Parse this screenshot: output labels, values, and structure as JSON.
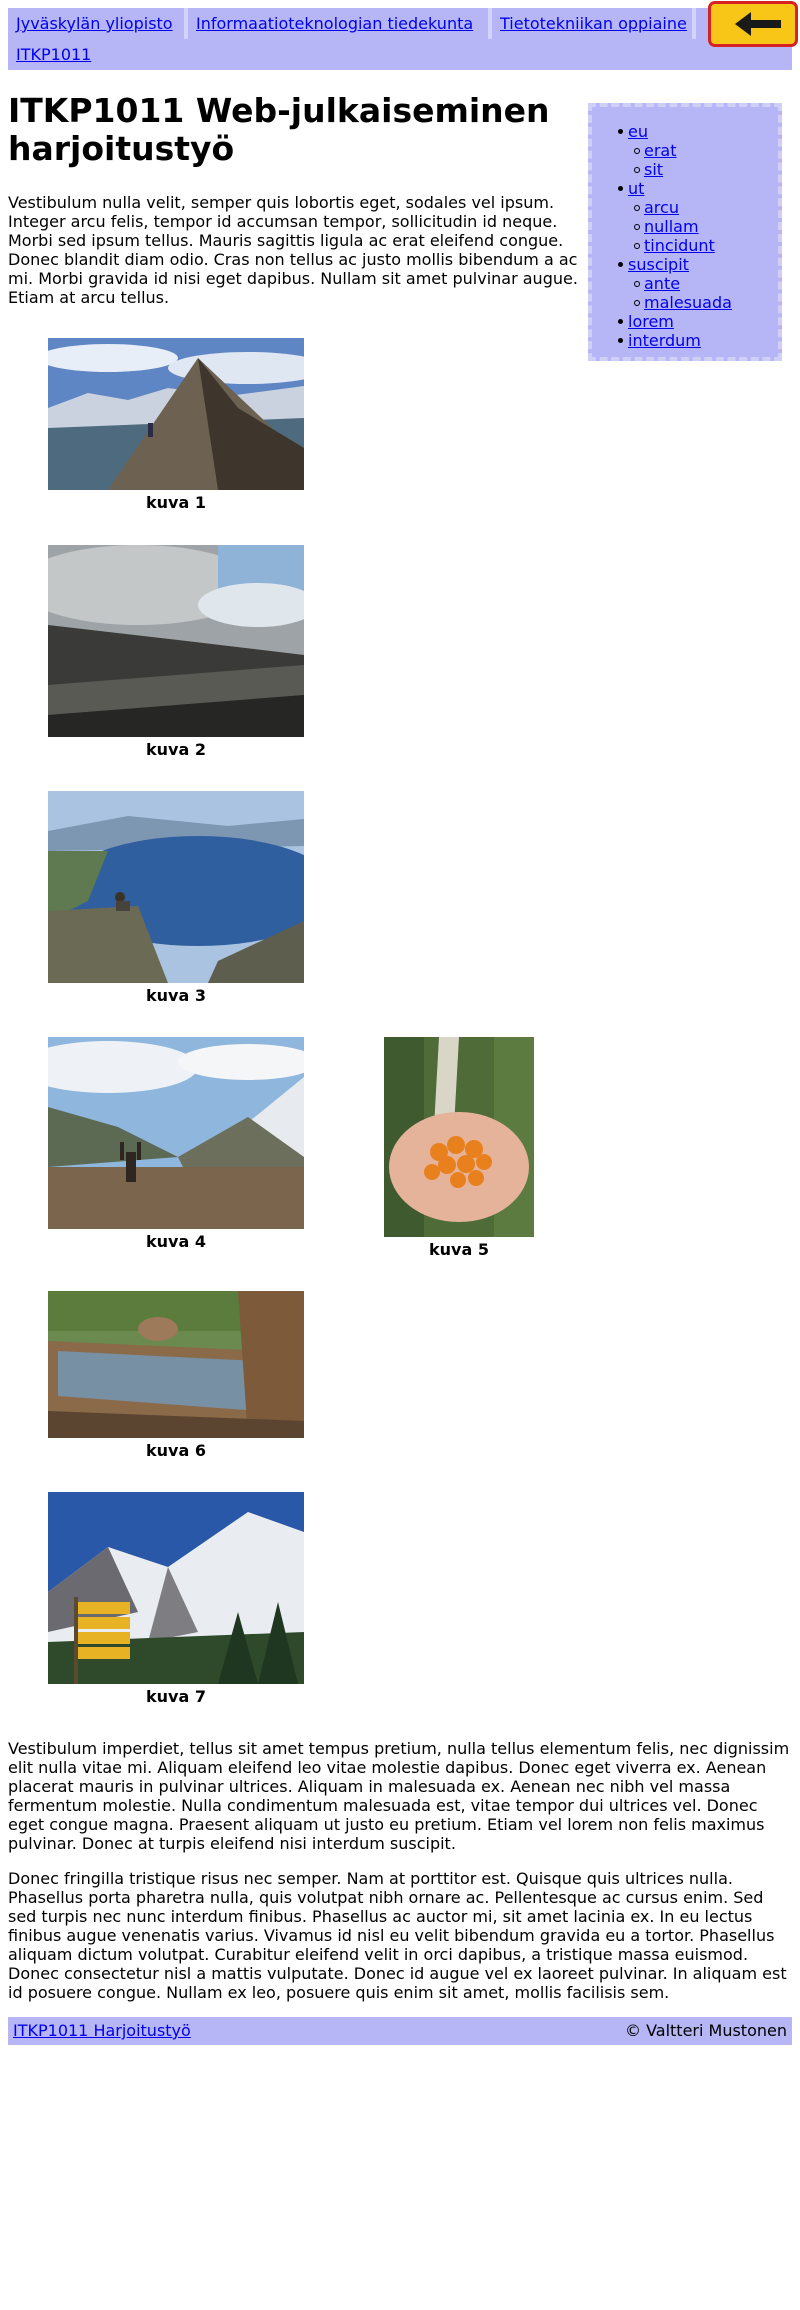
{
  "breadcrumb": [
    {
      "label": "Jyväskylän yliopisto"
    },
    {
      "label": "Informaatioteknologian tiedekunta"
    },
    {
      "label": "Tietotekniikan oppiaine"
    },
    {
      "label": "ITKP1011"
    }
  ],
  "back_button": {
    "icon": "arrow-left-icon",
    "colors": {
      "fill": "#f7c616",
      "border": "#d62222",
      "arrow": "#1a1a1a"
    }
  },
  "page": {
    "title": "ITKP1011 Web-julkaiseminen harjoitustyö",
    "intro": "Vestibulum nulla velit, semper quis lobortis eget, sodales vel ipsum. Integer arcu felis, tempor id accumsan tempor, sollicitudin id neque. Morbi sed ipsum tellus. Mauris sagittis ligula ac erat eleifend congue. Donec blandit diam odio. Cras non tellus ac justo mollis bibendum a ac mi. Morbi gravida id nisi eget dapibus. Nullam sit amet pulvinar augue. Etiam at arcu tellus."
  },
  "sidenav": {
    "items": [
      {
        "label": "eu",
        "children": [
          {
            "label": "erat"
          },
          {
            "label": "sit"
          }
        ]
      },
      {
        "label": "ut",
        "children": [
          {
            "label": "arcu"
          },
          {
            "label": "nullam"
          },
          {
            "label": "tincidunt"
          }
        ]
      },
      {
        "label": "suscipit",
        "children": [
          {
            "label": "ante"
          },
          {
            "label": "malesuada"
          }
        ]
      },
      {
        "label": "lorem",
        "children": []
      },
      {
        "label": "interdum",
        "children": []
      }
    ]
  },
  "gallery": [
    {
      "caption": "kuva 1",
      "scene": "mountain-ridge"
    },
    {
      "caption": "kuva 2",
      "scene": "cloudy-slope"
    },
    {
      "caption": "kuva 3",
      "scene": "fjord-lake"
    },
    {
      "caption": "kuva 4",
      "scene": "valley-hiker"
    },
    {
      "caption": "kuva 5",
      "scene": "cloudberries-hand"
    },
    {
      "caption": "kuva 6",
      "scene": "wooden-trough"
    },
    {
      "caption": "kuva 7",
      "scene": "snowy-peak-signpost"
    }
  ],
  "body_paragraphs": [
    "Vestibulum imperdiet, tellus sit amet tempus pretium, nulla tellus elementum felis, nec dignissim elit nulla vitae mi. Aliquam eleifend leo vitae molestie dapibus. Donec eget viverra ex. Aenean placerat mauris in pulvinar ultrices. Aliquam in malesuada ex. Aenean nec nibh vel massa fermentum molestie. Nulla condimentum malesuada est, vitae tempor dui ultrices vel. Donec eget congue magna. Praesent aliquam ut justo eu pretium. Etiam vel lorem non felis maximus pulvinar. Donec at turpis eleifend nisi interdum suscipit.",
    "Donec fringilla tristique risus nec semper. Nam at porttitor est. Quisque quis ultrices nulla. Phasellus porta pharetra nulla, quis volutpat nibh ornare ac. Pellentesque ac cursus enim. Sed sed turpis nec nunc interdum finibus. Phasellus ac auctor mi, sit amet lacinia ex. In eu lectus finibus augue venenatis varius. Vivamus id nisl eu velit bibendum gravida eu a tortor. Phasellus aliquam dictum volutpat. Curabitur eleifend velit in orci dapibus, a tristique massa euismod. Donec consectetur nisl a mattis vulputate. Donec id augue vel ex laoreet pulvinar. In aliquam est id posuere congue. Nullam ex leo, posuere quis enim sit amet, mollis facilisis sem."
  ],
  "footer": {
    "link_label": "ITKP1011 Harjoitustyö",
    "copyright": "© Valtteri Mustonen"
  },
  "colors": {
    "nav_bg": "#b6b6f6",
    "link": "#0000ee"
  }
}
